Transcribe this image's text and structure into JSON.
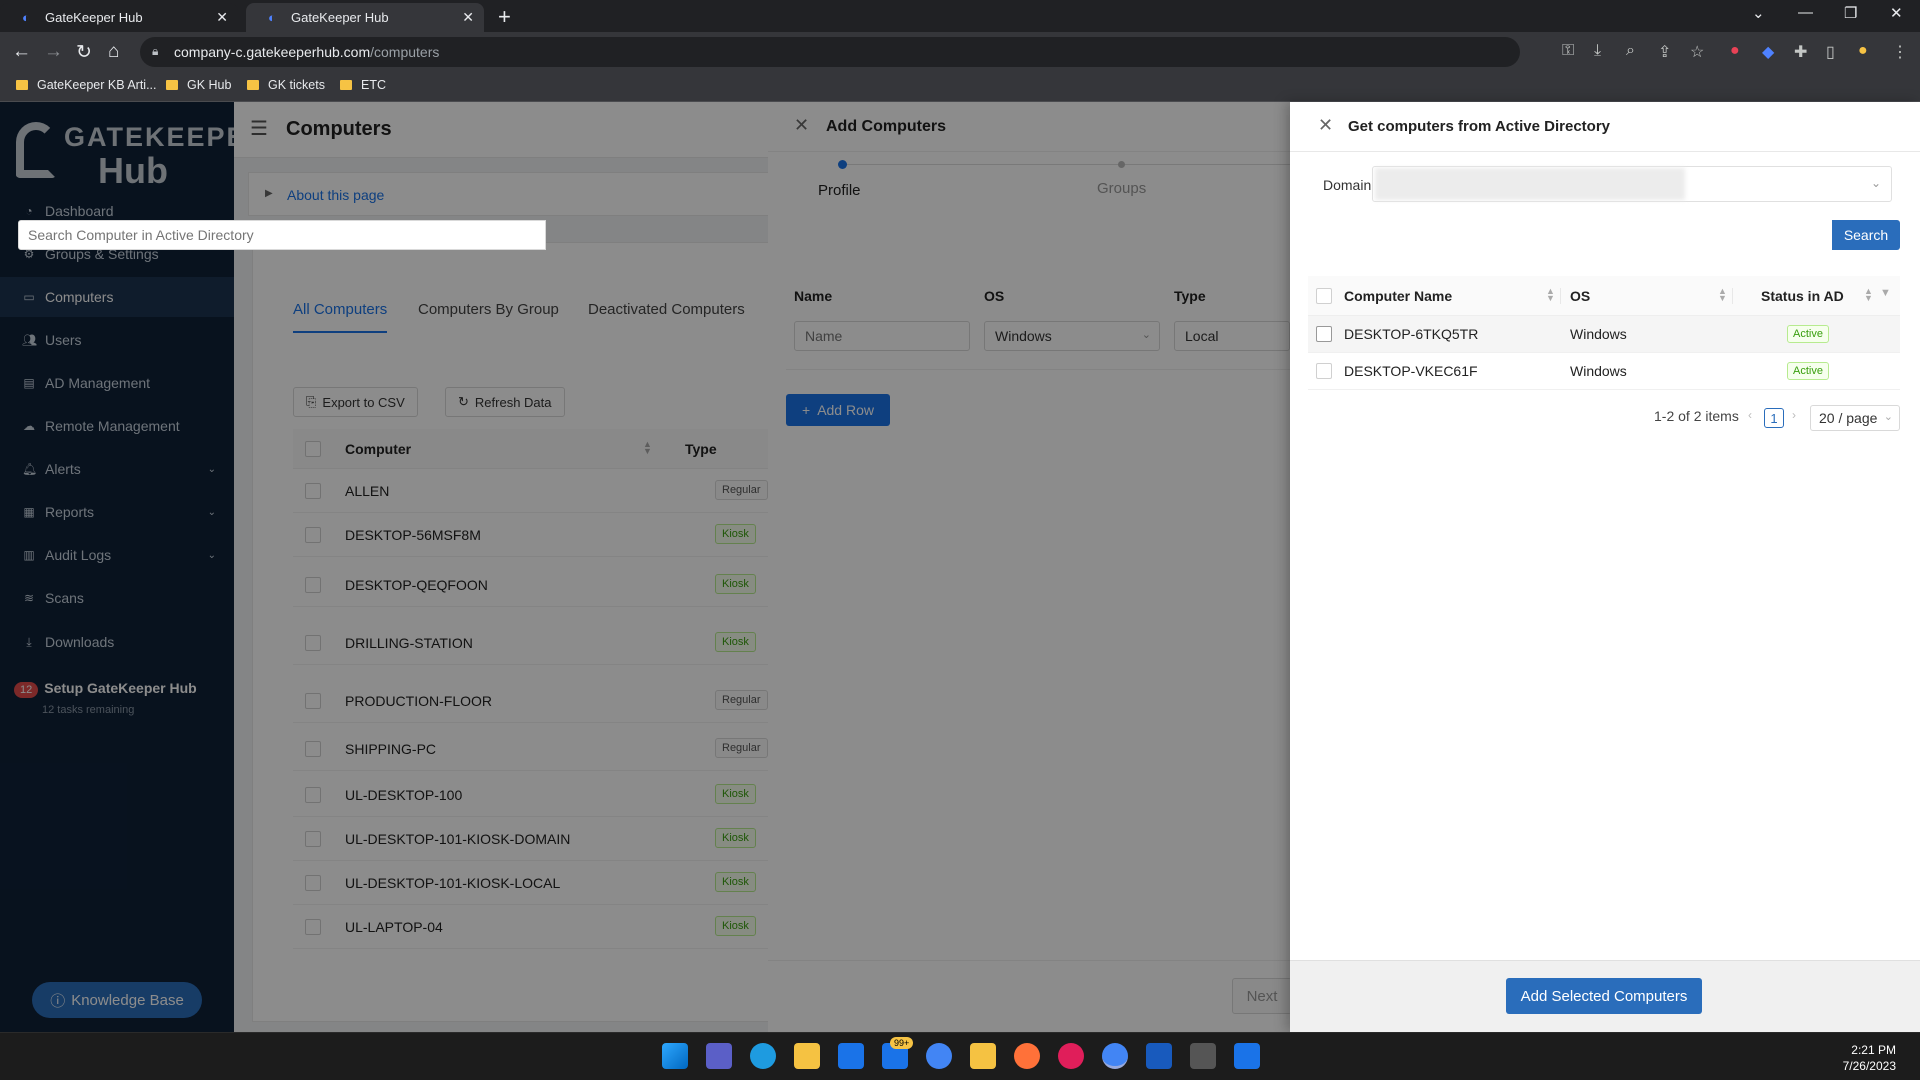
{
  "browser": {
    "tabs": [
      {
        "label": "GateKeeper Hub"
      },
      {
        "label": "GateKeeper Hub"
      }
    ],
    "url_host": "company-c.gatekeeperhub.com",
    "url_path": "/computers",
    "bookmarks": [
      "GateKeeper KB Arti...",
      "GK Hub",
      "GK tickets",
      "ETC"
    ]
  },
  "sidebar": {
    "logo_top": "GATEKEEPER",
    "logo_bottom": "Hub",
    "items": [
      {
        "label": "Dashboard",
        "icon": "dashboard-icon"
      },
      {
        "label": "Groups & Settings",
        "icon": "gear-icon"
      },
      {
        "label": "Computers",
        "icon": "computer-icon"
      },
      {
        "label": "Users",
        "icon": "users-icon"
      },
      {
        "label": "AD Management",
        "icon": "ad-icon"
      },
      {
        "label": "Remote Management",
        "icon": "remote-icon"
      },
      {
        "label": "Alerts",
        "icon": "bell-icon"
      },
      {
        "label": "Reports",
        "icon": "reports-icon"
      },
      {
        "label": "Audit Logs",
        "icon": "audit-icon"
      },
      {
        "label": "Scans",
        "icon": "wifi-icon"
      },
      {
        "label": "Downloads",
        "icon": "download-icon"
      }
    ],
    "setup_badge": "12",
    "setup_title": "Setup GateKeeper Hub",
    "setup_sub": "12 tasks remaining",
    "kb_button": "Knowledge Base"
  },
  "header": {
    "title": "Computers"
  },
  "about": "About this page",
  "computers": {
    "tabs": [
      "All Computers",
      "Computers By Group",
      "Deactivated Computers"
    ],
    "export_label": "Export to CSV",
    "refresh_label": "Refresh Data",
    "col_computer": "Computer",
    "col_type": "Type",
    "rows": [
      {
        "name": "ALLEN",
        "type": "Regular"
      },
      {
        "name": "DESKTOP-56MSF8M",
        "type": "Kiosk"
      },
      {
        "name": "DESKTOP-QEQFOON",
        "type": "Kiosk"
      },
      {
        "name": "DRILLING-STATION",
        "type": "Kiosk"
      },
      {
        "name": "PRODUCTION-FLOOR",
        "type": "Regular"
      },
      {
        "name": "SHIPPING-PC",
        "type": "Regular"
      },
      {
        "name": "UL-DESKTOP-100",
        "type": "Kiosk"
      },
      {
        "name": "UL-DESKTOP-101-KIOSK-DOMAIN",
        "type": "Kiosk"
      },
      {
        "name": "UL-DESKTOP-101-KIOSK-LOCAL",
        "type": "Kiosk"
      },
      {
        "name": "UL-LAPTOP-04",
        "type": "Kiosk"
      }
    ]
  },
  "add_drawer": {
    "title": "Add Computers",
    "steps": [
      "Profile",
      "Groups"
    ],
    "col_name": "Name",
    "col_os": "OS",
    "col_type": "Type",
    "name_placeholder": "Name",
    "os_value": "Windows",
    "type_value": "Local",
    "add_row": "Add Row",
    "next": "Next"
  },
  "ad_drawer": {
    "title": "Get computers from Active Directory",
    "domain_label": "Domain",
    "search_placeholder": "Search Computer in Active Directory",
    "search_button": "Search",
    "col_name": "Computer Name",
    "col_os": "OS",
    "col_status": "Status in AD",
    "rows": [
      {
        "name": "DESKTOP-6TKQ5TR",
        "os": "Windows",
        "status": "Active"
      },
      {
        "name": "DESKTOP-VKEC61F",
        "os": "Windows",
        "status": "Active"
      }
    ],
    "pagination_text": "1-2 of 2 items",
    "current_page": "1",
    "page_size": "20 / page",
    "add_selected": "Add Selected Computers"
  },
  "taskbar": {
    "mail_badge": "99+",
    "time": "2:21 PM",
    "date": "7/26/2023"
  },
  "colors": {
    "accent": "#2a6dbb",
    "sidebar": "#0f2138",
    "active_tag": "#389e0d"
  }
}
